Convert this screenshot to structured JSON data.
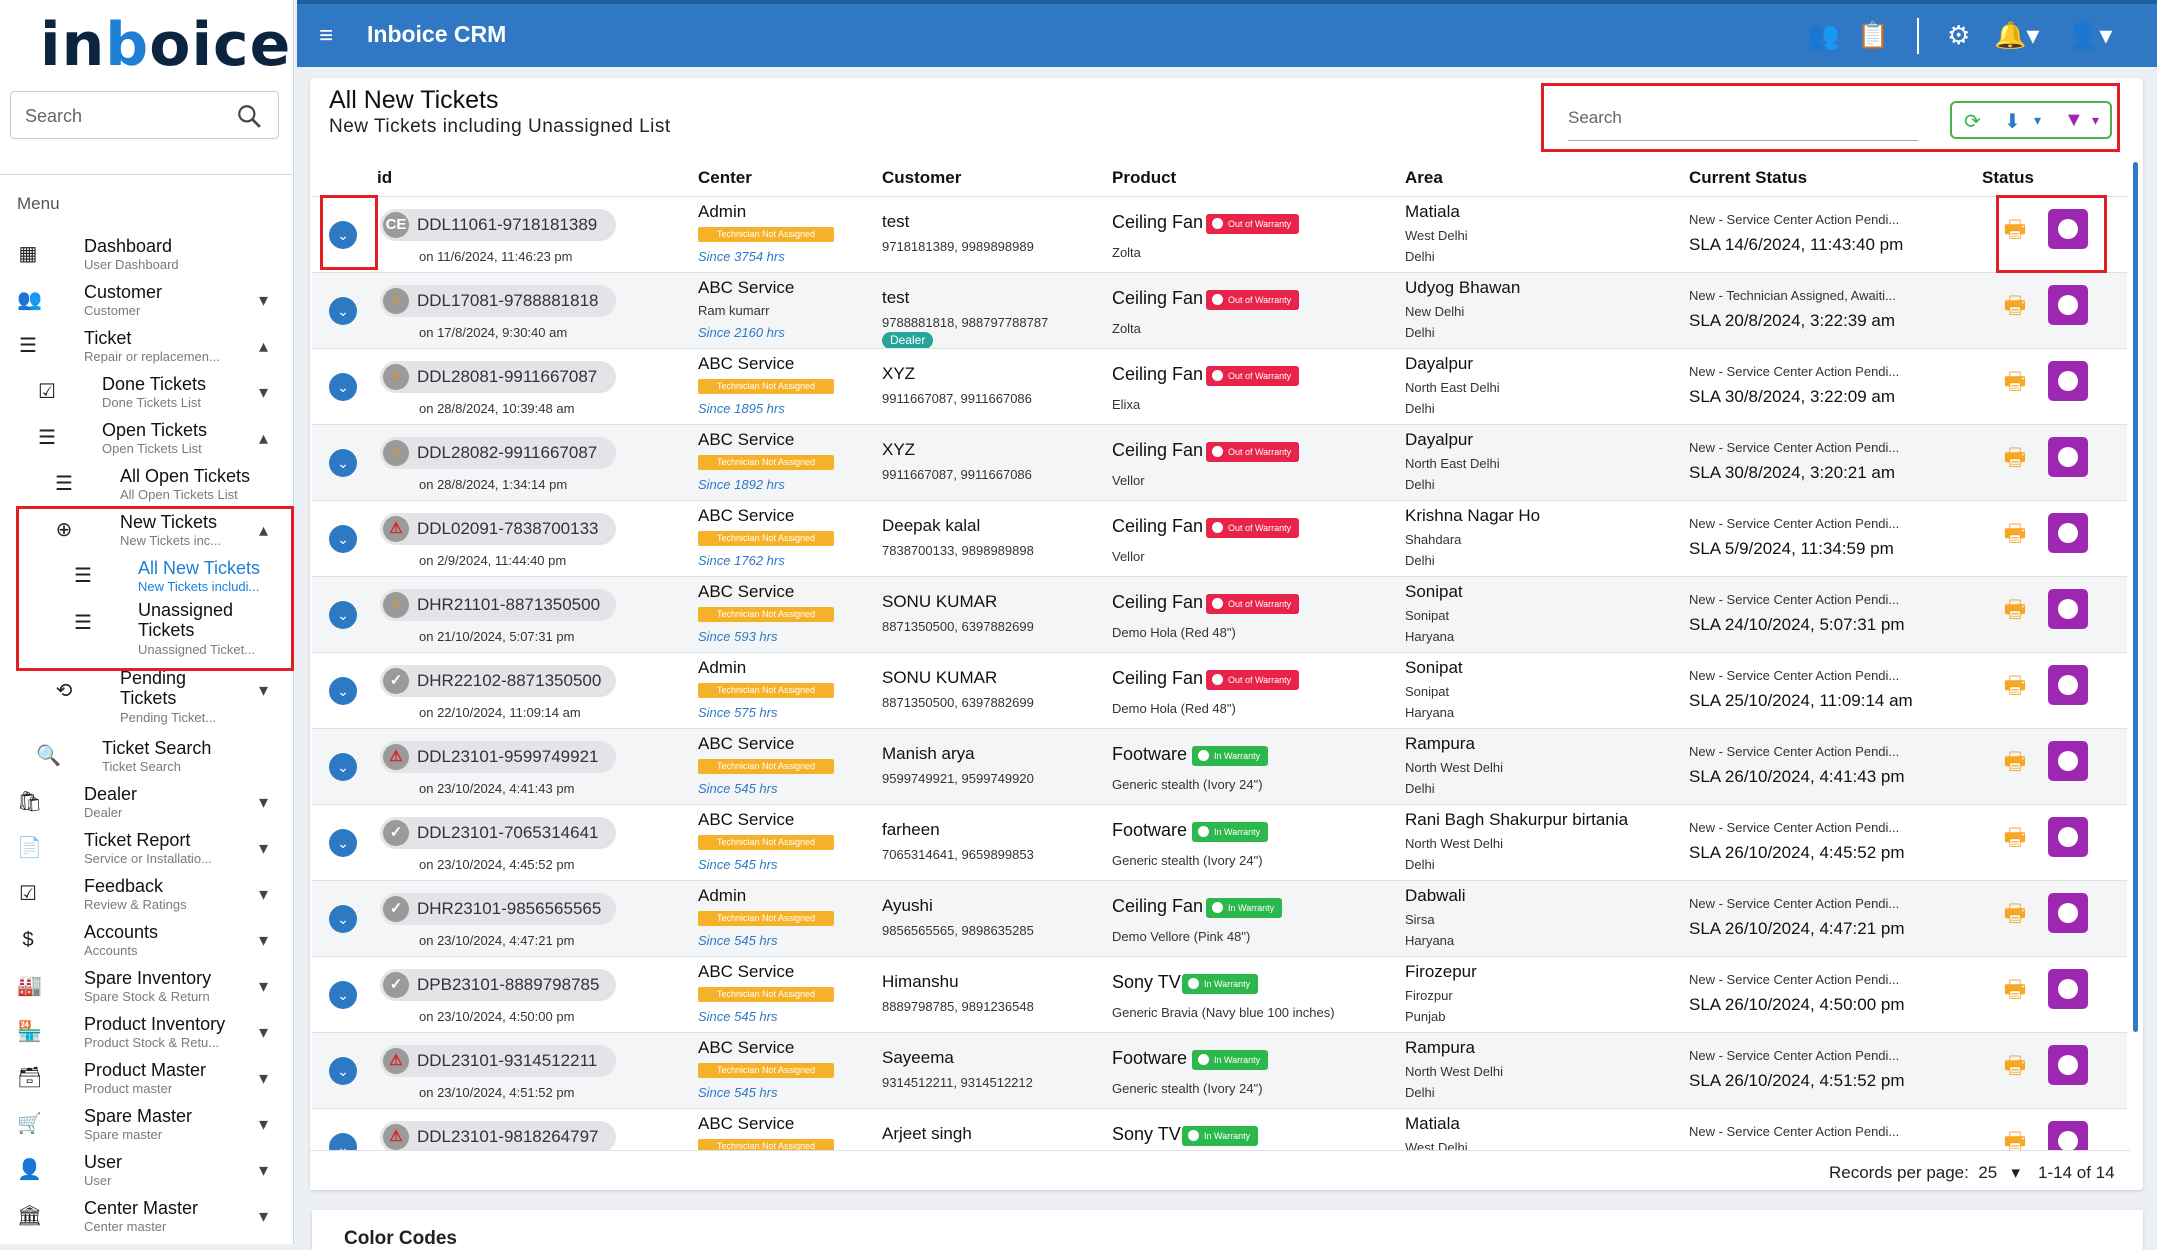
{
  "app": {
    "logo": "inboice",
    "title": "Inboice CRM"
  },
  "sidebar": {
    "search_placeholder": "Search",
    "menu_heading": "Menu",
    "items": [
      {
        "label": "Dashboard",
        "sub": "User Dashboard"
      },
      {
        "label": "Customer",
        "sub": "Customer"
      },
      {
        "label": "Ticket",
        "sub": "Repair or replacemen..."
      },
      {
        "label": "Done Tickets",
        "sub": "Done Tickets List"
      },
      {
        "label": "Open Tickets",
        "sub": "Open Tickets List"
      },
      {
        "label": "All Open Tickets",
        "sub": "All Open Tickets List"
      },
      {
        "label": "New Tickets",
        "sub": "New Tickets inc..."
      },
      {
        "label": "All New Tickets",
        "sub": "New Tickets includi..."
      },
      {
        "label": "Unassigned",
        "label2": "Tickets",
        "sub": "Unassigned Ticket..."
      },
      {
        "label": "Pending",
        "label2": "Tickets",
        "sub": "Pending Ticket..."
      },
      {
        "label": "Ticket Search",
        "sub": "Ticket Search"
      },
      {
        "label": "Dealer",
        "sub": "Dealer"
      },
      {
        "label": "Ticket Report",
        "sub": "Service or Installatio..."
      },
      {
        "label": "Feedback",
        "sub": "Review & Ratings"
      },
      {
        "label": "Accounts",
        "sub": "Accounts"
      },
      {
        "label": "Spare Inventory",
        "sub": "Spare Stock & Return"
      },
      {
        "label": "Product Inventory",
        "sub": "Product Stock & Retu..."
      },
      {
        "label": "Product Master",
        "sub": "Product master"
      },
      {
        "label": "Spare Master",
        "sub": "Spare master"
      },
      {
        "label": "User",
        "sub": "User"
      },
      {
        "label": "Center Master",
        "sub": "Center master"
      }
    ]
  },
  "page": {
    "title": "All New Tickets",
    "subtitle": "New Tickets including Unassigned List",
    "search_placeholder": "Search"
  },
  "table": {
    "headers": [
      "id",
      "Center",
      "Customer",
      "Product",
      "Area",
      "Current Status",
      "Status"
    ],
    "rows": [
      {
        "icon": "CE",
        "icon_type": "g",
        "id": "DDL11061-9718181389",
        "date": "on 11/6/2024, 11:46:23 pm",
        "center": "Admin",
        "badge": "Technician Not Assigned",
        "since": "Since 3754 hrs",
        "customer": "test",
        "phone": "9718181389, 9989898989",
        "product": "Ceiling Fan",
        "warranty": "Out of Warranty",
        "warr_type": "out",
        "model": "Zolta",
        "area": "Matiala",
        "area2": "West Delhi",
        "area3": "Delhi",
        "status": "New - Service Center Action Pendi...",
        "sla": "SLA 14/6/2024, 11:43:40 pm"
      },
      {
        "icon": "!",
        "icon_type": "o",
        "id": "DDL17081-9788881818",
        "date": "on 17/8/2024, 9:30:40 am",
        "center": "ABC Service",
        "csub": "Ram kumarr",
        "since": "Since 2160 hrs",
        "customer": "test",
        "phone": "9788881818, 988797788787",
        "dealer": "Dealer",
        "product": "Ceiling Fan",
        "warranty": "Out of Warranty",
        "warr_type": "out",
        "model": "Zolta",
        "area": "Udyog Bhawan",
        "area2": "New Delhi",
        "area3": "Delhi",
        "status": "New - Technician Assigned, Awaiti...",
        "sla": "SLA 20/8/2024, 3:22:39 am"
      },
      {
        "icon": "!",
        "icon_type": "o",
        "id": "DDL28081-9911667087",
        "date": "on 28/8/2024, 10:39:48 am",
        "center": "ABC Service",
        "badge": "Technician Not Assigned",
        "since": "Since 1895 hrs",
        "customer": "XYZ",
        "phone": "9911667087, 9911667086",
        "product": "Ceiling Fan",
        "warranty": "Out of Warranty",
        "warr_type": "out",
        "model": "Elixa",
        "area": "Dayalpur",
        "area2": "North East Delhi",
        "area3": "Delhi",
        "status": "New - Service Center Action Pendi...",
        "sla": "SLA 30/8/2024, 3:22:09 am"
      },
      {
        "icon": "!",
        "icon_type": "o",
        "id": "DDL28082-9911667087",
        "date": "on 28/8/2024, 1:34:14 pm",
        "center": "ABC Service",
        "badge": "Technician Not Assigned",
        "since": "Since 1892 hrs",
        "customer": "XYZ",
        "phone": "9911667087, 9911667086",
        "product": "Ceiling Fan",
        "warranty": "Out of Warranty",
        "warr_type": "out",
        "model": "Vellor",
        "area": "Dayalpur",
        "area2": "North East Delhi",
        "area3": "Delhi",
        "status": "New - Service Center Action Pendi...",
        "sla": "SLA 30/8/2024, 3:20:21 am"
      },
      {
        "icon": "⚠",
        "icon_type": "r",
        "id": "DDL02091-7838700133",
        "date": "on 2/9/2024, 11:44:40 pm",
        "center": "ABC Service",
        "badge": "Technician Not Assigned",
        "since": "Since 1762 hrs",
        "customer": "Deepak kalal",
        "phone": "7838700133, 9898989898",
        "product": "Ceiling Fan",
        "warranty": "Out of Warranty",
        "warr_type": "out",
        "model": "Vellor",
        "area": "Krishna Nagar Ho",
        "area2": "Shahdara",
        "area3": "Delhi",
        "status": "New - Service Center Action Pendi...",
        "sla": "SLA 5/9/2024, 11:34:59 pm"
      },
      {
        "icon": "!",
        "icon_type": "o",
        "id": "DHR21101-8871350500",
        "date": "on 21/10/2024, 5:07:31 pm",
        "center": "ABC Service",
        "badge": "Technician Not Assigned",
        "since": "Since 593 hrs",
        "customer": "SONU KUMAR",
        "phone": "8871350500, 6397882699",
        "product": "Ceiling Fan",
        "warranty": "Out of Warranty",
        "warr_type": "out",
        "model": "Demo Hola (Red 48\")",
        "area": "Sonipat",
        "area2": "Sonipat",
        "area3": "Haryana",
        "status": "New - Service Center Action Pendi...",
        "sla": "SLA 24/10/2024, 5:07:31 pm"
      },
      {
        "icon": "✓",
        "icon_type": "g",
        "id": "DHR22102-8871350500",
        "date": "on 22/10/2024, 11:09:14 am",
        "center": "Admin",
        "badge": "Technician Not Assigned",
        "since": "Since 575 hrs",
        "customer": "SONU KUMAR",
        "phone": "8871350500, 6397882699",
        "product": "Ceiling Fan",
        "warranty": "Out of Warranty",
        "warr_type": "out",
        "model": "Demo Hola (Red 48\")",
        "area": "Sonipat",
        "area2": "Sonipat",
        "area3": "Haryana",
        "status": "New - Service Center Action Pendi...",
        "sla": "SLA 25/10/2024, 11:09:14 am"
      },
      {
        "icon": "⚠",
        "icon_type": "r",
        "id": "DDL23101-9599749921",
        "date": "on 23/10/2024, 4:41:43 pm",
        "center": "ABC Service",
        "badge": "Technician Not Assigned",
        "since": "Since 545 hrs",
        "customer": "Manish arya",
        "phone": "9599749921, 9599749920",
        "product": "Footware",
        "warranty": "In Warranty",
        "warr_type": "in",
        "model": "Generic stealth (Ivory 24\")",
        "area": "Rampura",
        "area2": "North West Delhi",
        "area3": "Delhi",
        "status": "New - Service Center Action Pendi...",
        "sla": "SLA 26/10/2024, 4:41:43 pm"
      },
      {
        "icon": "✓",
        "icon_type": "g",
        "id": "DDL23101-7065314641",
        "date": "on 23/10/2024, 4:45:52 pm",
        "center": "ABC Service",
        "badge": "Technician Not Assigned",
        "since": "Since 545 hrs",
        "customer": "farheen",
        "phone": "7065314641, 9659899853",
        "product": "Footware",
        "warranty": "In Warranty",
        "warr_type": "in",
        "model": "Generic stealth (Ivory 24\")",
        "area": "Rani Bagh Shakurpur birtania",
        "area2": "North West Delhi",
        "area3": "Delhi",
        "status": "New - Service Center Action Pendi...",
        "sla": "SLA 26/10/2024, 4:45:52 pm"
      },
      {
        "icon": "✓",
        "icon_type": "g",
        "id": "DHR23101-9856565565",
        "date": "on 23/10/2024, 4:47:21 pm",
        "center": "Admin",
        "badge": "Technician Not Assigned",
        "since": "Since 545 hrs",
        "customer": "Ayushi",
        "phone": "9856565565, 9898635285",
        "product": "Ceiling Fan",
        "warranty": "In Warranty",
        "warr_type": "in",
        "model": "Demo Vellore (Pink 48\")",
        "area": "Dabwali",
        "area2": "Sirsa",
        "area3": "Haryana",
        "status": "New - Service Center Action Pendi...",
        "sla": "SLA 26/10/2024, 4:47:21 pm"
      },
      {
        "icon": "✓",
        "icon_type": "g",
        "id": "DPB23101-8889798785",
        "date": "on 23/10/2024, 4:50:00 pm",
        "center": "ABC Service",
        "badge": "Technician Not Assigned",
        "since": "Since 545 hrs",
        "customer": "Himanshu",
        "phone": "8889798785, 9891236548",
        "product": "Sony TV",
        "warranty": "In Warranty",
        "warr_type": "in",
        "model": "Generic Bravia (Navy blue 100 inches)",
        "area": "Firozepur",
        "area2": "Firozpur",
        "area3": "Punjab",
        "status": "New - Service Center Action Pendi...",
        "sla": "SLA 26/10/2024, 4:50:00 pm"
      },
      {
        "icon": "⚠",
        "icon_type": "r",
        "id": "DDL23101-9314512211",
        "date": "on 23/10/2024, 4:51:52 pm",
        "center": "ABC Service",
        "badge": "Technician Not Assigned",
        "since": "Since 545 hrs",
        "customer": "Sayeema",
        "phone": "9314512211, 9314512212",
        "product": "Footware",
        "warranty": "In Warranty",
        "warr_type": "in",
        "model": "Generic stealth (Ivory 24\")",
        "area": "Rampura",
        "area2": "North West Delhi",
        "area3": "Delhi",
        "status": "New - Service Center Action Pendi...",
        "sla": "SLA 26/10/2024, 4:51:52 pm"
      },
      {
        "icon": "⚠",
        "icon_type": "r",
        "id": "DDL23101-9818264797",
        "date": "",
        "center": "ABC Service",
        "badge": "Technician Not Assigned",
        "since": "",
        "customer": "Arjeet singh",
        "phone": "",
        "product": "Sony TV",
        "warranty": "In Warranty",
        "warr_type": "in",
        "model": "",
        "area": "Matiala",
        "area2": "West Delhi",
        "area3": "",
        "status": "New - Service Center Action Pendi...",
        "sla": ""
      }
    ]
  },
  "footer": {
    "rows_label": "Records per page:",
    "rows_value": "25",
    "range": "1-14 of 14"
  },
  "color_codes": "Color Codes",
  "colors": {
    "primary": "#3078c4",
    "accent_purple": "#9c27b0",
    "print": "#f5a623",
    "highlight": "#e31e24"
  }
}
